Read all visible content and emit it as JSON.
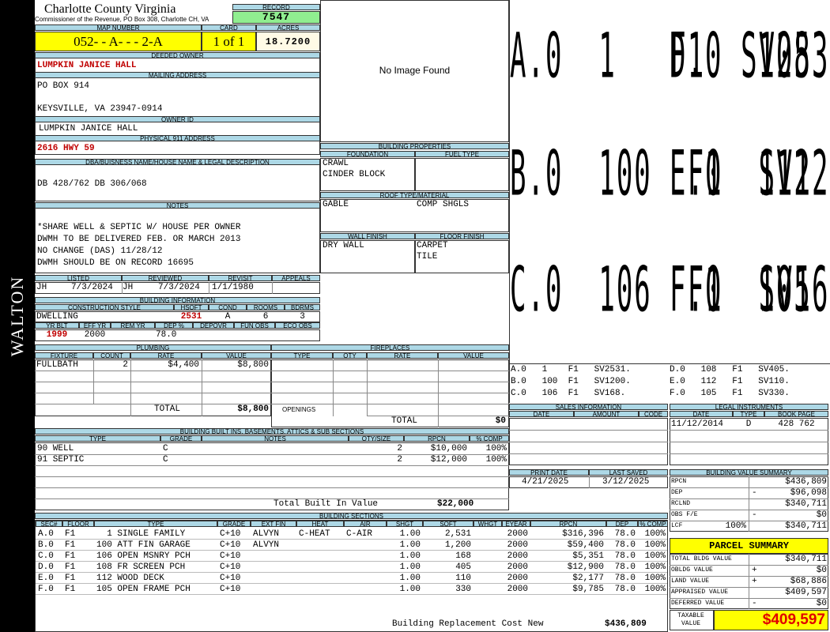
{
  "side_label": "WALTON",
  "header": {
    "county": "Charlotte County Virginia",
    "subtitle": "Commissioner of the Revenue, PO Box 308, Charlotte CH, VA",
    "record_label": "RECORD",
    "record_value": "7547",
    "map_number_label": "MAP NUMBER",
    "map_number": "052- - A- - - 2-A",
    "card_label": "CARD",
    "card": "1 of 1",
    "acres_label": "ACRES",
    "acres": "18.7200"
  },
  "owner": {
    "deeded_owner_label": "DEEDED OWNER",
    "deeded_owner": "LUMPKIN JANICE HALL",
    "mailing_label": "MAILING ADDRESS",
    "mailing_line1": "PO BOX 914",
    "mailing_line2": "KEYSVILLE, VA 23947-0914",
    "owner_id_label": "OWNER ID",
    "owner_id": "LUMPKIN JANICE HALL",
    "physical_label": "PHYSICAL 911 ADDRESS",
    "physical": "2616 HWY 59"
  },
  "image_placeholder": "No Image Found",
  "legal": {
    "label": "DBA/BUISNESS NAME/HOUSE NAME & LEGAL DESCRIPTION",
    "text": "DB 428/762 DB 306/068"
  },
  "notes": {
    "label": "NOTES",
    "lines": [
      "*SHARE WELL & SEPTIC W/ HOUSE PER OWNER",
      "DWMH TO BE DELIVERED FEB. OR MARCH 2013",
      "NO CHANGE (DAS) 11/28/12",
      "DWMH SHOULD BE ON RECORD 16695"
    ]
  },
  "building_properties": {
    "label": "BUILDING PROPERTIES",
    "foundation_label": "FOUNDATION",
    "fuel_label": "FUEL TYPE",
    "foundation": [
      "CRAWL",
      "CINDER BLOCK"
    ],
    "roof_label": "ROOF TYPE/MATERIAL",
    "roof_type": "GABLE",
    "roof_material": "COMP SHGLS",
    "wall_label": "WALL FINISH",
    "floor_label": "FLOOR FINISH",
    "wall": "DRY WALL",
    "floor": [
      "CARPET",
      "TILE"
    ]
  },
  "listing": {
    "listed_label": "LISTED",
    "reviewed_label": "REVIEWED",
    "revisit_label": "REVISIT",
    "appeals_label": "APPEALS",
    "listed_by": "JH",
    "listed_date": "7/3/2024",
    "reviewed_by": "JH",
    "reviewed_date": "7/3/2024",
    "revisit": "1/1/1980"
  },
  "building_info": {
    "label": "BUILDING INFORMATION",
    "cols": [
      "CONSTRUCTION STYLE",
      "HSQFT",
      "COND",
      "ROOMS",
      "BDRMS"
    ],
    "style": "DWELLING",
    "hsqft": "2531",
    "cond": "A",
    "rooms": "6",
    "bdrms": "3",
    "cols2": [
      "YR BLT",
      "EFF YR",
      "REM YR",
      "DEP %",
      "DEPOVR",
      "FUN OBS",
      "ECO OBS"
    ],
    "yr_blt": "1999",
    "eff_yr": "2000",
    "dep": "78.0"
  },
  "plumbing": {
    "label": "PLUMBING",
    "cols": [
      "FIXTURE",
      "COUNT",
      "RATE",
      "VALUE"
    ],
    "rows": [
      {
        "fixture": "FULLBATH",
        "count": "2",
        "rate": "$4,400",
        "value": "$8,800"
      }
    ],
    "total_label": "TOTAL",
    "total": "$8,800"
  },
  "fireplaces": {
    "label": "FIREPLACES",
    "cols": [
      "TYPE",
      "QTY",
      "RATE",
      "VALUE"
    ],
    "openings_label": "OPENINGS",
    "total_label": "TOTAL",
    "total": "$0"
  },
  "sketch": {
    "big": [
      [
        "A.0  1   F1  SV2531.",
        "D.0  108  F1  SV405."
      ],
      [
        "B.0  100  F1  SV1200.",
        "E.0  112  F1  SV110."
      ],
      [
        "C.0  106  F1  SV168.",
        "F.0  105  F1  SV330."
      ]
    ],
    "small": [
      [
        "A.0   1    F1   SV2531.",
        "D.0   108   F1   SV405."
      ],
      [
        "B.0   100  F1   SV1200.",
        "E.0   112   F1   SV110."
      ],
      [
        "C.0   106  F1   SV168.",
        "F.0   105   F1   SV330."
      ]
    ]
  },
  "sales": {
    "label": "SALES INFORMATION",
    "cols": [
      "DATE",
      "AMOUNT",
      "CODE"
    ]
  },
  "legal_instruments": {
    "label": "LEGAL INSTRUMENTS",
    "cols": [
      "DATE",
      "TYPE",
      "BOOK PAGE"
    ],
    "rows": [
      {
        "date": "11/12/2014",
        "type": "D",
        "book": "428 762"
      }
    ]
  },
  "builtins": {
    "label": "BUILDING BUILT INS, BASEMENTS, ATTICS & SUB SECTIONS",
    "cols": [
      "TYPE",
      "GRADE",
      "NOTES",
      "QTY/SIZE",
      "RPCN",
      "% COMP"
    ],
    "rows": [
      {
        "type": "90 WELL",
        "grade": "C",
        "qty": "2",
        "rpcn": "$10,000",
        "comp": "100%"
      },
      {
        "type": "91 SEPTIC",
        "grade": "C",
        "qty": "2",
        "rpcn": "$12,000",
        "comp": "100%"
      }
    ],
    "total_label": "Total Built In Value",
    "total": "$22,000"
  },
  "print": {
    "print_label": "PRINT DATE",
    "saved_label": "LAST SAVED",
    "print_date": "4/21/2025",
    "last_saved": "3/12/2025"
  },
  "value_summary": {
    "label": "BUILDING VALUE SUMMARY",
    "rows": [
      {
        "label": "RPCN",
        "sign": "",
        "value": "$436,809"
      },
      {
        "label": "DEP",
        "sign": "-",
        "value": "$96,098"
      },
      {
        "label": "RCLND",
        "sign": "",
        "value": "$340,711"
      },
      {
        "label": "OBS F/E",
        "sign": "-",
        "value": "$0"
      },
      {
        "label": "LCF",
        "pct": "100%",
        "sign": "",
        "value": "$340,711"
      }
    ]
  },
  "parcel_summary": {
    "label": "PARCEL SUMMARY",
    "rows": [
      {
        "label": "TOTAL BLDG VALUE",
        "sign": "",
        "value": "$340,711"
      },
      {
        "label": "OBLDG VALUE",
        "sign": "+",
        "value": "$0"
      },
      {
        "label": "LAND VALUE",
        "sign": "+",
        "value": "$68,886"
      },
      {
        "label": "APPRAISED VALUE",
        "sign": "",
        "value": "$409,597"
      },
      {
        "label": "DEFERRED VALUE",
        "sign": "-",
        "value": "$0"
      }
    ],
    "taxable_label": "TAXABLE VALUE",
    "taxable": "$409,597"
  },
  "sections": {
    "label": "BUILDING SECTIONS",
    "cols": [
      "SEC#",
      "FLOOR",
      "TYPE",
      "GRADE",
      "EXT FIN",
      "HEAT",
      "AIR",
      "SHGT",
      "SQFT",
      "WHGT",
      "EYEAR",
      "RPCN",
      "DEP",
      "% COMP"
    ],
    "rows": [
      {
        "sec": "A.0",
        "floor": "F1",
        "type": "  1 SINGLE FAMILY",
        "grade": "C+10",
        "ext": "ALVYN",
        "heat": "C-HEAT",
        "air": "C-AIR",
        "shgt": "1.00",
        "sqft": "2,531",
        "eyear": "2000",
        "rpcn": "$316,396",
        "dep": "78.0",
        "comp": "100%"
      },
      {
        "sec": "B.0",
        "floor": "F1",
        "type": "100 ATT FIN GARAGE",
        "grade": "C+10",
        "ext": "ALVYN",
        "heat": "",
        "air": "",
        "shgt": "1.00",
        "sqft": "1,200",
        "eyear": "2000",
        "rpcn": "$59,400",
        "dep": "78.0",
        "comp": "100%"
      },
      {
        "sec": "C.0",
        "floor": "F1",
        "type": "106 OPEN MSNRY PCH",
        "grade": "C+10",
        "ext": "",
        "heat": "",
        "air": "",
        "shgt": "1.00",
        "sqft": "168",
        "eyear": "2000",
        "rpcn": "$5,351",
        "dep": "78.0",
        "comp": "100%"
      },
      {
        "sec": "D.0",
        "floor": "F1",
        "type": "108 FR SCREEN PCH",
        "grade": "C+10",
        "ext": "",
        "heat": "",
        "air": "",
        "shgt": "1.00",
        "sqft": "405",
        "eyear": "2000",
        "rpcn": "$12,900",
        "dep": "78.0",
        "comp": "100%"
      },
      {
        "sec": "E.0",
        "floor": "F1",
        "type": "112 WOOD DECK",
        "grade": "C+10",
        "ext": "",
        "heat": "",
        "air": "",
        "shgt": "1.00",
        "sqft": "110",
        "eyear": "2000",
        "rpcn": "$2,177",
        "dep": "78.0",
        "comp": "100%"
      },
      {
        "sec": "F.0",
        "floor": "F1",
        "type": "105 OPEN FRAME PCH",
        "grade": "C+10",
        "ext": "",
        "heat": "",
        "air": "",
        "shgt": "1.00",
        "sqft": "330",
        "eyear": "2000",
        "rpcn": "$9,785",
        "dep": "78.0",
        "comp": "100%"
      }
    ],
    "total_label": "Building Replacement Cost New",
    "total": "$436,809"
  }
}
